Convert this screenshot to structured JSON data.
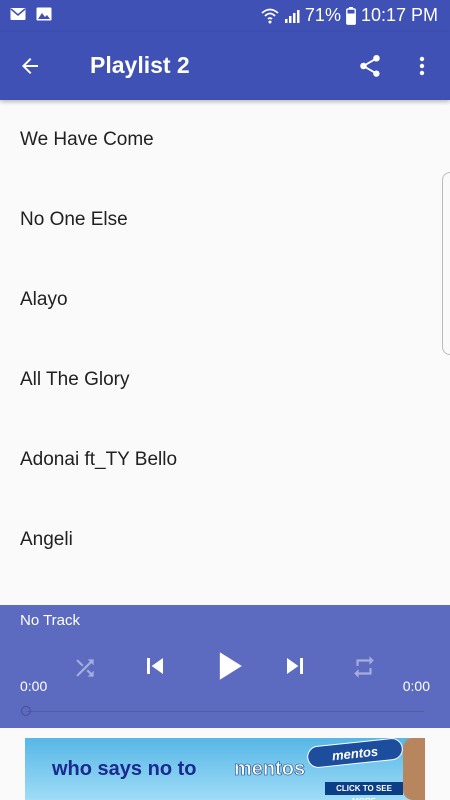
{
  "status_bar": {
    "battery": "71%",
    "time": "10:17 PM",
    "icons": [
      "mail-icon",
      "image-icon",
      "wifi-icon",
      "signal-icon",
      "battery-icon"
    ]
  },
  "app_bar": {
    "title": "Playlist 2",
    "icons": [
      "back-arrow-icon",
      "share-icon",
      "more-vert-icon"
    ]
  },
  "tracks": [
    "We Have Come",
    "No One Else",
    "Alayo",
    "All The Glory",
    "Adonai ft_TY Bello",
    "Angeli"
  ],
  "player": {
    "now_playing": "No Track",
    "current_time": "0:00",
    "total_time": "0:00",
    "progress": 0,
    "icons": [
      "shuffle-icon",
      "previous-icon",
      "play-icon",
      "next-icon",
      "repeat-icon"
    ]
  },
  "ad": {
    "headline": "who says no to",
    "brand": "mentos",
    "pack_label": "mentos",
    "cta": "CLICK TO SEE MORE"
  },
  "colors": {
    "primary": "#3f51b5",
    "player": "#5c6bc0",
    "background": "#fafafa",
    "text": "#212121"
  }
}
